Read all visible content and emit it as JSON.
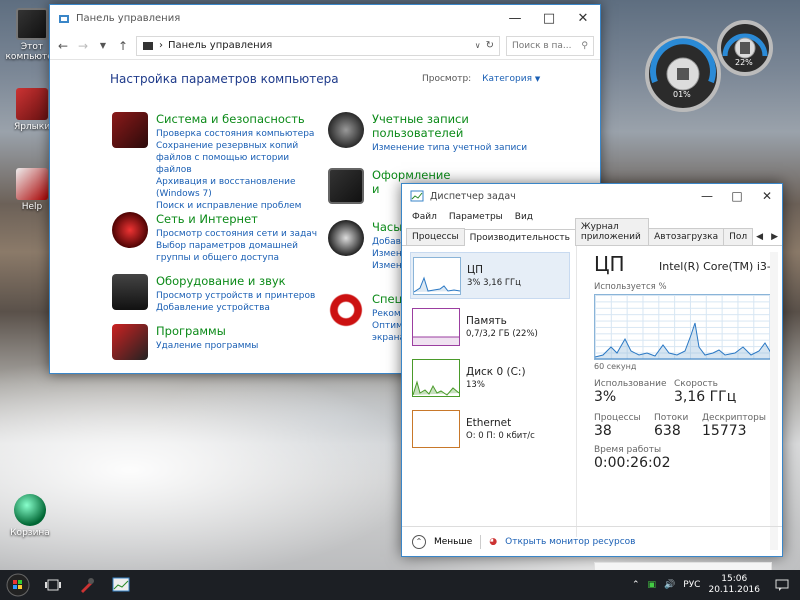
{
  "desktop": {
    "icons": [
      {
        "label": "Этот компьютер"
      },
      {
        "label": "Ярлыки"
      },
      {
        "label": "Help"
      },
      {
        "label": "Корзина"
      }
    ]
  },
  "gadget": {
    "cpu": "01%",
    "ram": "22%"
  },
  "control_panel": {
    "title": "Панель управления",
    "address": "Панель управления",
    "search_placeholder": "Поиск в па...",
    "heading": "Настройка параметров компьютера",
    "view_by_label": "Просмотр:",
    "view_by_value": "Категория",
    "categories": [
      {
        "title": "Система и безопасность",
        "links": [
          "Проверка состояния компьютера",
          "Сохранение резервных копий файлов с помощью истории файлов",
          "Архивация и восстановление (Windows 7)",
          "Поиск и исправление проблем"
        ]
      },
      {
        "title": "Сеть и Интернет",
        "links": [
          "Просмотр состояния сети и задач",
          "Выбор параметров домашней группы и общего доступа"
        ]
      },
      {
        "title": "Оборудование и звук",
        "links": [
          "Просмотр устройств и принтеров",
          "Добавление устройства"
        ]
      },
      {
        "title": "Программы",
        "links": [
          "Удаление программы"
        ]
      },
      {
        "title": "Учетные записи пользователей",
        "links": [
          "Изменение типа учетной записи"
        ]
      },
      {
        "title": "Оформление и",
        "links": []
      },
      {
        "title": "Часы",
        "links": [
          "Добав",
          "Измен",
          "Измен"
        ]
      },
      {
        "title": "Специ",
        "links": [
          "Реком",
          "Оптим",
          "экрана"
        ]
      }
    ]
  },
  "task_manager": {
    "title": "Диспетчер задач",
    "menu": [
      "Файл",
      "Параметры",
      "Вид"
    ],
    "tabs": [
      "Процессы",
      "Производительность",
      "Журнал приложений",
      "Автозагрузка",
      "Пол"
    ],
    "resources": [
      {
        "name": "ЦП",
        "value": "3%  3,16 ГГц"
      },
      {
        "name": "Память",
        "value": "0,7/3,2 ГБ (22%)"
      },
      {
        "name": "Диск 0 (C:)",
        "value": "13%"
      },
      {
        "name": "Ethernet",
        "value": "О: 0 П: 0 кбит/с"
      }
    ],
    "detail": {
      "title": "ЦП",
      "model": "Intel(R) Core(TM) i3-",
      "usage_label": "Используется %",
      "graph_label": "60 секунд",
      "utilization_label": "Использование",
      "utilization": "3%",
      "speed_label": "Скорость",
      "speed": "3,16 ГГц",
      "processes_label": "Процессы",
      "processes": "38",
      "threads_label": "Потоки",
      "threads": "638",
      "handles_label": "Дескрипторы",
      "handles": "15773",
      "uptime_label": "Время работы",
      "uptime": "0:00:26:02"
    },
    "fewer_details": "Меньше",
    "resource_monitor": "Открыть монитор ресурсов"
  },
  "taskbar": {
    "language": "РУС",
    "time": "15:06",
    "date": "20.11.2016"
  },
  "colors": {
    "accent": "#1a5fb4",
    "category_title": "#0b8a18",
    "window_border": "#3a86c8"
  }
}
